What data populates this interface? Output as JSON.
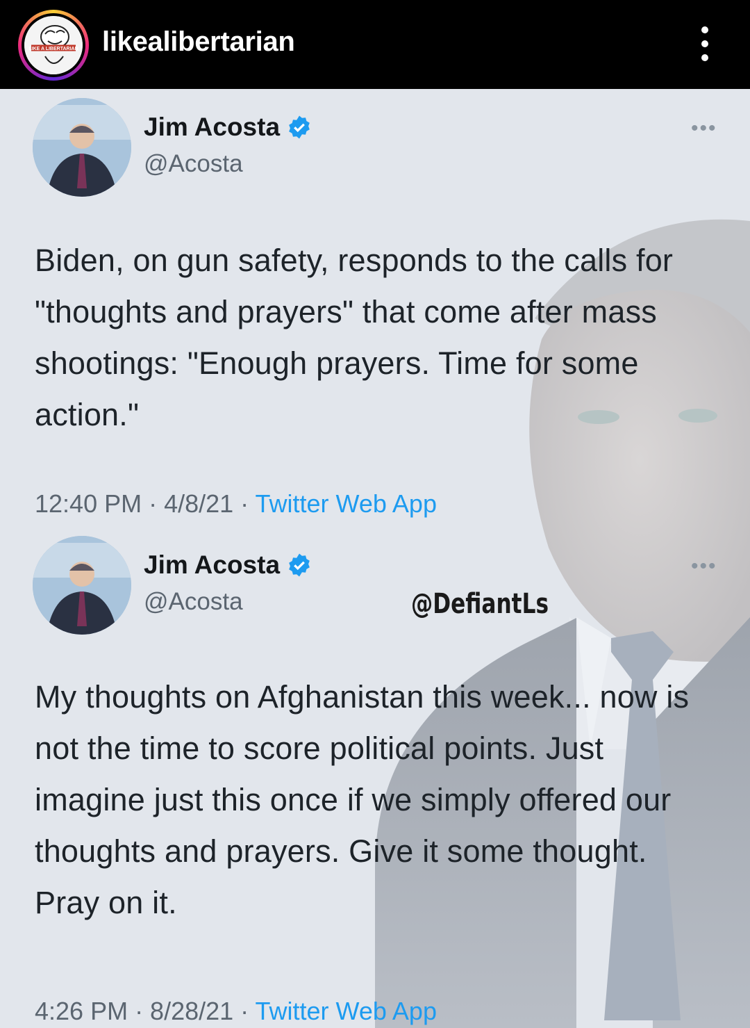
{
  "instagram": {
    "username": "likealibertarian",
    "avatar_icon": "libertarian-logo-icon",
    "avatar_text": "LIKE A LIBERTARIAN",
    "more_icon": "vertical-ellipsis-icon"
  },
  "tweets": [
    {
      "name": "Jim Acosta",
      "handle": "@Acosta",
      "verified_icon": "verified-badge-icon",
      "more_label": "•••",
      "text": "Biden, on gun safety, responds to the calls for \"thoughts and prayers\" that come after mass shootings: \"Enough prayers. Time for some action.\"",
      "time": "12:40 PM · 4/8/21 · ",
      "app": "Twitter Web App"
    },
    {
      "name": "Jim Acosta",
      "handle": "@Acosta",
      "verified_icon": "verified-badge-icon",
      "more_label": "•••",
      "text": "My thoughts on Afghanistan this week... now is not the time to score political points. Just imagine just this once if we simply offered our thoughts and prayers. Give it some thought. Pray on it.",
      "time": "4:26 PM · 8/28/21 · ",
      "app": "Twitter Web App"
    }
  ],
  "watermark": "@DefiantLs",
  "colors": {
    "twitter_blue": "#1d9bf0",
    "header_bg": "#000000",
    "post_bg": "#dfe3ea"
  }
}
